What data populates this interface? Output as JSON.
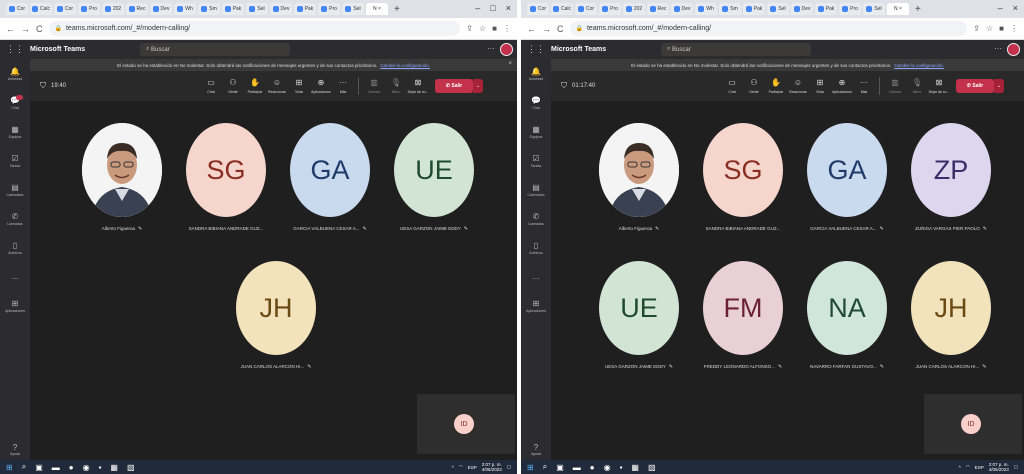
{
  "left": {
    "tab_labels": [
      "Cor",
      "Calc",
      "Cor",
      "Pro",
      "202",
      "Rec",
      "Dev",
      "Wh",
      "Sm",
      "Pak",
      "Sel",
      "Dev",
      "Pak",
      "Pro",
      "Sel",
      "N",
      "×"
    ],
    "url": "teams.microsoft.com/_#/modern-calling/",
    "app_name": "Microsoft Teams",
    "search_placeholder": "Buscar",
    "rail": [
      "Actividad",
      "Chat",
      "Equipos",
      "Tareas",
      "Calendario",
      "Llamadas",
      "Archivos",
      "...",
      "Aplicaciones",
      "Ayuda"
    ],
    "notice_text": "El estado se ha establecido en No molestar. Solo obtendrá las notificaciones de mensajes urgentes y de sus contactos prioritarios.",
    "notice_link": "Cambie la configuración.",
    "timer": "19:40",
    "controls": [
      "Chat",
      "Gente",
      "Participar",
      "Reaccionar",
      "Vista",
      "Aplicaciones",
      "Más",
      "Cámara",
      "Micro",
      "Dejar de co..."
    ],
    "leave_label": "Salir",
    "participants": [
      {
        "initials": "",
        "name": "Alberto Figueroa",
        "photo": true
      },
      {
        "initials": "SG",
        "name": "SANDRA BIBIANA ANDRADE GUZ...",
        "bg": "#f5d5cc",
        "fg": "#8a2e22"
      },
      {
        "initials": "GA",
        "name": "GARCIA VALBUENA CESAR A...",
        "bg": "#c9d9ee",
        "fg": "#1f3b6a"
      },
      {
        "initials": "UE",
        "name": "UESA GARZON JAIME EDDY",
        "bg": "#d2e4d4",
        "fg": "#1f4a30"
      },
      {
        "initials": "JH",
        "name": "JUAN CARLOS ALARCON HI...",
        "bg": "#f3e3bd",
        "fg": "#6a4a12"
      }
    ],
    "self_initials": "ID"
  },
  "right": {
    "url": "teams.microsoft.com/_#/modern-calling/",
    "app_name": "Microsoft Teams",
    "search_placeholder": "Buscar",
    "notice_text": "El estado se ha establecido en No molestar. Solo obtendrá las notificaciones de mensajes urgentes y de sus contactos prioritarios.",
    "notice_link": "Cambie la configuración.",
    "timer": "01:17:40",
    "controls": [
      "Chat",
      "Gente",
      "Participar",
      "Reaccionar",
      "Vista",
      "Aplicaciones",
      "Más",
      "Cámara",
      "Micro",
      "Dejar de co..."
    ],
    "leave_label": "Salir",
    "participants": [
      {
        "initials": "",
        "name": "Alberto Figueroa",
        "photo": true
      },
      {
        "initials": "SG",
        "name": "SANDRA BIBIANA ANDRADE GUZ...",
        "bg": "#f5d5cc",
        "fg": "#8a2e22"
      },
      {
        "initials": "GA",
        "name": "GARCIA VALBUENA CESAR A...",
        "bg": "#c9d9ee",
        "fg": "#1f3b6a"
      },
      {
        "initials": "ZP",
        "name": "ZUÑIGA VARGAS PIER PAOLO",
        "bg": "#dcd7ee",
        "fg": "#3a2e6a"
      },
      {
        "initials": "UE",
        "name": "UESA GARZON JAIME EDDY",
        "bg": "#d2e4d4",
        "fg": "#1f4a30"
      },
      {
        "initials": "FM",
        "name": "FREDDY LEONARDO ALFONSO...",
        "bg": "#e9cfd6",
        "fg": "#6a1f36"
      },
      {
        "initials": "NA",
        "name": "NAVARRO FARFAN GUSTAVO...",
        "bg": "#d0e6da",
        "fg": "#1f4a36"
      },
      {
        "initials": "JH",
        "name": "JUAN CARLOS ALARCON HI...",
        "bg": "#f3e3bd",
        "fg": "#6a4a12"
      }
    ],
    "self_initials": "ID"
  },
  "taskbar": {
    "lang": "ESP",
    "time": "2:07 p. m.",
    "date": "4/05/2023"
  }
}
